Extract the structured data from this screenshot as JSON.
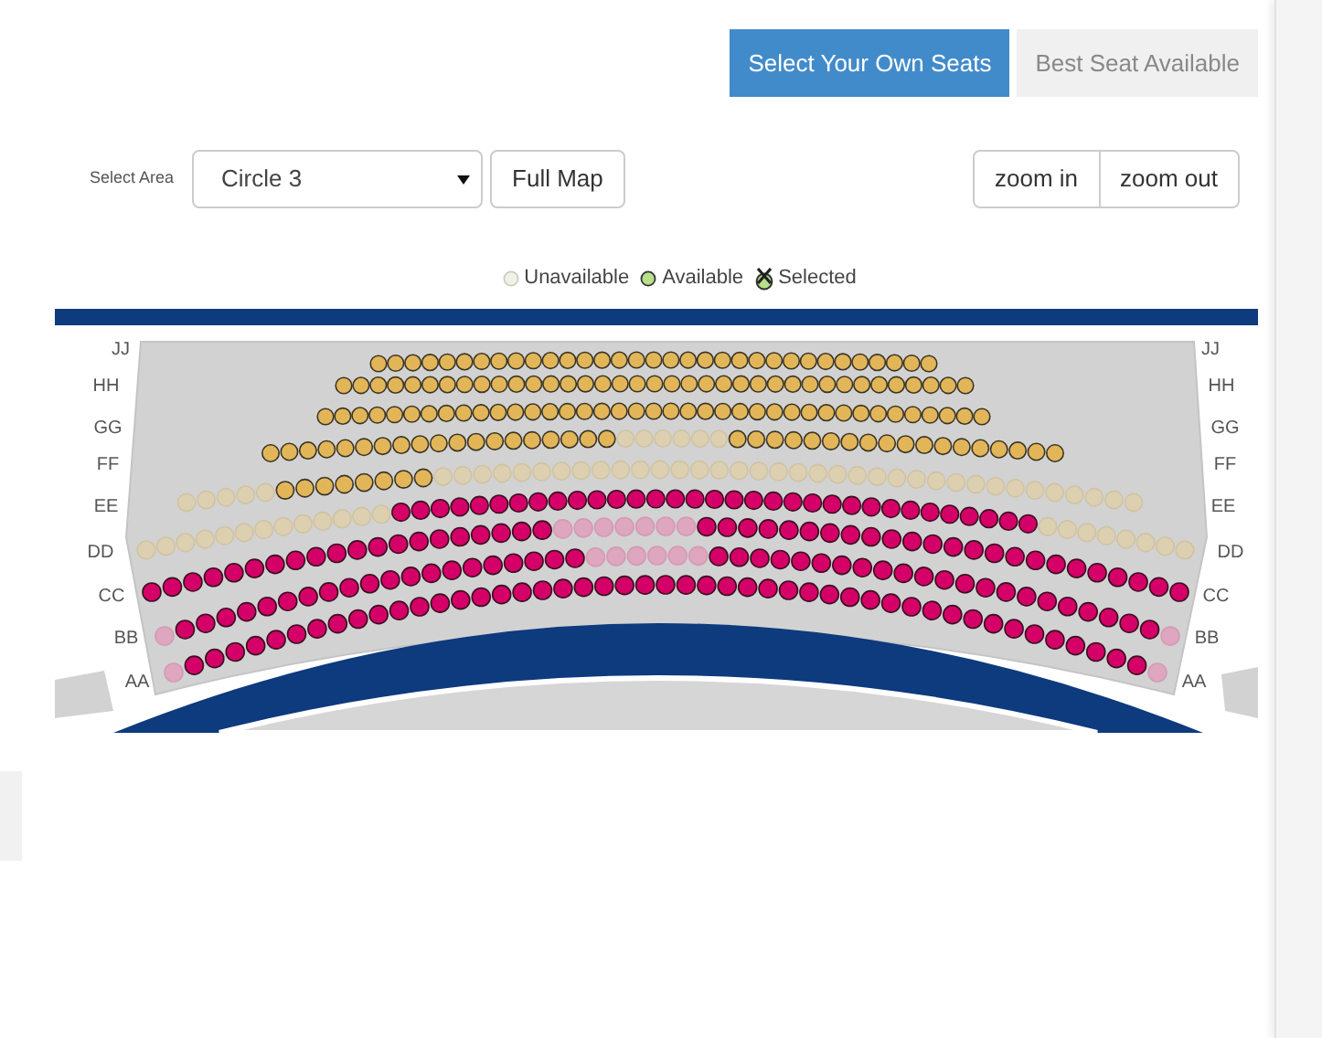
{
  "booking_modes": [
    {
      "label": "Select Your Own Seats",
      "selected": true
    },
    {
      "label": "Best Seat Available",
      "selected": false
    }
  ],
  "area": {
    "label": "Select Area",
    "value": "Circle 3",
    "full_map": "Full Map"
  },
  "zoom": {
    "zoom_in": "zoom in",
    "zoom_out": "zoom out"
  },
  "legend": [
    {
      "kind": "unavailable",
      "label": "Unavailable"
    },
    {
      "kind": "available",
      "label": "Available"
    },
    {
      "kind": "selected",
      "label": "Selected"
    }
  ],
  "seat_map": {
    "rows": [
      {
        "left_label": "JJ",
        "right_label": "JJ",
        "seats": [
          {
            "kind": "upper",
            "available": true
          },
          {
            "kind": "upper",
            "available": true
          },
          {
            "kind": "upper",
            "available": true
          },
          {
            "kind": "upper",
            "available": true
          },
          {
            "kind": "upper",
            "available": true
          },
          {
            "kind": "upper",
            "available": true
          },
          {
            "kind": "upper",
            "available": true
          },
          {
            "kind": "upper",
            "available": true
          },
          {
            "kind": "upper",
            "available": true
          },
          {
            "kind": "upper",
            "available": true
          },
          {
            "kind": "upper",
            "available": true
          },
          {
            "kind": "upper",
            "available": true
          },
          {
            "kind": "upper",
            "available": true
          },
          {
            "kind": "upper",
            "available": true
          },
          {
            "kind": "upper",
            "available": true
          },
          {
            "kind": "upper",
            "available": true
          },
          {
            "kind": "upper",
            "available": true
          },
          {
            "kind": "upper",
            "available": true
          },
          {
            "kind": "upper",
            "available": true
          },
          {
            "kind": "upper",
            "available": true
          },
          {
            "kind": "upper",
            "available": true
          },
          {
            "kind": "upper",
            "available": true
          },
          {
            "kind": "upper",
            "available": true
          },
          {
            "kind": "upper",
            "available": true
          },
          {
            "kind": "upper",
            "available": true
          },
          {
            "kind": "upper",
            "available": true
          },
          {
            "kind": "upper",
            "available": true
          },
          {
            "kind": "upper",
            "available": true
          },
          {
            "kind": "upper",
            "available": true
          },
          {
            "kind": "upper",
            "available": true
          },
          {
            "kind": "upper",
            "available": true
          },
          {
            "kind": "upper",
            "available": true
          },
          {
            "kind": "upper",
            "available": true
          }
        ]
      },
      {
        "left_label": "HH",
        "right_label": "HH",
        "seats": [
          {
            "kind": "upper",
            "available": true
          },
          {
            "kind": "upper",
            "available": true
          },
          {
            "kind": "upper",
            "available": true
          },
          {
            "kind": "upper",
            "available": true
          },
          {
            "kind": "upper",
            "available": true
          },
          {
            "kind": "upper",
            "available": true
          },
          {
            "kind": "upper",
            "available": true
          },
          {
            "kind": "upper",
            "available": true
          },
          {
            "kind": "upper",
            "available": true
          },
          {
            "kind": "upper",
            "available": true
          },
          {
            "kind": "upper",
            "available": true
          },
          {
            "kind": "upper",
            "available": true
          },
          {
            "kind": "upper",
            "available": true
          },
          {
            "kind": "upper",
            "available": true
          },
          {
            "kind": "upper",
            "available": true
          },
          {
            "kind": "upper",
            "available": true
          },
          {
            "kind": "upper",
            "available": true
          },
          {
            "kind": "upper",
            "available": true
          },
          {
            "kind": "upper",
            "available": true
          },
          {
            "kind": "upper",
            "available": true
          },
          {
            "kind": "upper",
            "available": true
          },
          {
            "kind": "upper",
            "available": true
          },
          {
            "kind": "upper",
            "available": true
          },
          {
            "kind": "upper",
            "available": true
          },
          {
            "kind": "upper",
            "available": true
          },
          {
            "kind": "upper",
            "available": true
          },
          {
            "kind": "upper",
            "available": true
          },
          {
            "kind": "upper",
            "available": true
          },
          {
            "kind": "upper",
            "available": true
          },
          {
            "kind": "upper",
            "available": true
          },
          {
            "kind": "upper",
            "available": true
          },
          {
            "kind": "upper",
            "available": true
          },
          {
            "kind": "upper",
            "available": true
          },
          {
            "kind": "upper",
            "available": true
          },
          {
            "kind": "upper",
            "available": true
          },
          {
            "kind": "upper",
            "available": true
          },
          {
            "kind": "upper",
            "available": true
          }
        ]
      },
      {
        "left_label": "GG",
        "right_label": "GG",
        "seats": [
          {
            "kind": "upper",
            "available": true
          },
          {
            "kind": "upper",
            "available": true
          },
          {
            "kind": "upper",
            "available": true
          },
          {
            "kind": "upper",
            "available": true
          },
          {
            "kind": "upper",
            "available": true
          },
          {
            "kind": "upper",
            "available": true
          },
          {
            "kind": "upper",
            "available": true
          },
          {
            "kind": "upper",
            "available": true
          },
          {
            "kind": "upper",
            "available": true
          },
          {
            "kind": "upper",
            "available": true
          },
          {
            "kind": "upper",
            "available": true
          },
          {
            "kind": "upper",
            "available": true
          },
          {
            "kind": "upper",
            "available": true
          },
          {
            "kind": "upper",
            "available": true
          },
          {
            "kind": "upper",
            "available": true
          },
          {
            "kind": "upper",
            "available": true
          },
          {
            "kind": "upper",
            "available": true
          },
          {
            "kind": "upper",
            "available": true
          },
          {
            "kind": "upper",
            "available": true
          },
          {
            "kind": "upper",
            "available": true
          },
          {
            "kind": "upper",
            "available": true
          },
          {
            "kind": "upper",
            "available": true
          },
          {
            "kind": "upper",
            "available": true
          },
          {
            "kind": "upper",
            "available": true
          },
          {
            "kind": "upper",
            "available": true
          },
          {
            "kind": "upper",
            "available": true
          },
          {
            "kind": "upper",
            "available": true
          },
          {
            "kind": "upper",
            "available": true
          },
          {
            "kind": "upper",
            "available": true
          },
          {
            "kind": "upper",
            "available": true
          },
          {
            "kind": "upper",
            "available": true
          },
          {
            "kind": "upper",
            "available": true
          },
          {
            "kind": "upper",
            "available": true
          },
          {
            "kind": "upper",
            "available": true
          },
          {
            "kind": "upper",
            "available": true
          },
          {
            "kind": "upper",
            "available": true
          },
          {
            "kind": "upper",
            "available": true
          },
          {
            "kind": "upper",
            "available": true
          },
          {
            "kind": "upper",
            "available": true
          }
        ]
      },
      {
        "left_label": "FF",
        "right_label": "FF",
        "seats": [
          {
            "kind": "upper",
            "available": true
          },
          {
            "kind": "upper",
            "available": true
          },
          {
            "kind": "upper",
            "available": true
          },
          {
            "kind": "upper",
            "available": true
          },
          {
            "kind": "upper",
            "available": true
          },
          {
            "kind": "upper",
            "available": true
          },
          {
            "kind": "upper",
            "available": true
          },
          {
            "kind": "upper",
            "available": true
          },
          {
            "kind": "upper",
            "available": true
          },
          {
            "kind": "upper",
            "available": true
          },
          {
            "kind": "upper",
            "available": true
          },
          {
            "kind": "upper",
            "available": true
          },
          {
            "kind": "upper",
            "available": true
          },
          {
            "kind": "upper",
            "available": true
          },
          {
            "kind": "upper",
            "available": true
          },
          {
            "kind": "upper",
            "available": true
          },
          {
            "kind": "upper",
            "available": true
          },
          {
            "kind": "upper",
            "available": true
          },
          {
            "kind": "upper",
            "available": true
          },
          {
            "kind": "upper",
            "available": false
          },
          {
            "kind": "upper",
            "available": false
          },
          {
            "kind": "upper",
            "available": false
          },
          {
            "kind": "upper",
            "available": false
          },
          {
            "kind": "upper",
            "available": false
          },
          {
            "kind": "upper",
            "available": false
          },
          {
            "kind": "upper",
            "available": true
          },
          {
            "kind": "upper",
            "available": true
          },
          {
            "kind": "upper",
            "available": true
          },
          {
            "kind": "upper",
            "available": true
          },
          {
            "kind": "upper",
            "available": true
          },
          {
            "kind": "upper",
            "available": true
          },
          {
            "kind": "upper",
            "available": true
          },
          {
            "kind": "upper",
            "available": true
          },
          {
            "kind": "upper",
            "available": true
          },
          {
            "kind": "upper",
            "available": true
          },
          {
            "kind": "upper",
            "available": true
          },
          {
            "kind": "upper",
            "available": true
          },
          {
            "kind": "upper",
            "available": true
          },
          {
            "kind": "upper",
            "available": true
          },
          {
            "kind": "upper",
            "available": true
          },
          {
            "kind": "upper",
            "available": true
          },
          {
            "kind": "upper",
            "available": true
          },
          {
            "kind": "upper",
            "available": true
          }
        ]
      },
      {
        "left_label": "EE",
        "right_label": "EE",
        "seats": [
          {
            "kind": "upper",
            "available": false
          },
          {
            "kind": "upper",
            "available": false
          },
          {
            "kind": "upper",
            "available": false
          },
          {
            "kind": "upper",
            "available": false
          },
          {
            "kind": "upper",
            "available": false
          },
          {
            "kind": "upper",
            "available": true
          },
          {
            "kind": "upper",
            "available": true
          },
          {
            "kind": "upper",
            "available": true
          },
          {
            "kind": "upper",
            "available": true
          },
          {
            "kind": "upper",
            "available": true
          },
          {
            "kind": "upper",
            "available": true
          },
          {
            "kind": "upper",
            "available": true
          },
          {
            "kind": "upper",
            "available": true
          },
          {
            "kind": "upper",
            "available": false
          },
          {
            "kind": "upper",
            "available": false
          },
          {
            "kind": "upper",
            "available": false
          },
          {
            "kind": "upper",
            "available": false
          },
          {
            "kind": "upper",
            "available": false
          },
          {
            "kind": "upper",
            "available": false
          },
          {
            "kind": "upper",
            "available": false
          },
          {
            "kind": "upper",
            "available": false
          },
          {
            "kind": "upper",
            "available": false
          },
          {
            "kind": "upper",
            "available": false
          },
          {
            "kind": "upper",
            "available": false
          },
          {
            "kind": "upper",
            "available": false
          },
          {
            "kind": "upper",
            "available": false
          },
          {
            "kind": "upper",
            "available": false
          },
          {
            "kind": "upper",
            "available": false
          },
          {
            "kind": "upper",
            "available": false
          },
          {
            "kind": "upper",
            "available": false
          },
          {
            "kind": "upper",
            "available": false
          },
          {
            "kind": "upper",
            "available": false
          },
          {
            "kind": "upper",
            "available": false
          },
          {
            "kind": "upper",
            "available": false
          },
          {
            "kind": "upper",
            "available": false
          },
          {
            "kind": "upper",
            "available": false
          },
          {
            "kind": "upper",
            "available": false
          },
          {
            "kind": "upper",
            "available": false
          },
          {
            "kind": "upper",
            "available": false
          },
          {
            "kind": "upper",
            "available": false
          },
          {
            "kind": "upper",
            "available": false
          },
          {
            "kind": "upper",
            "available": false
          },
          {
            "kind": "upper",
            "available": false
          },
          {
            "kind": "upper",
            "available": false
          },
          {
            "kind": "upper",
            "available": false
          },
          {
            "kind": "upper",
            "available": false
          },
          {
            "kind": "upper",
            "available": false
          },
          {
            "kind": "upper",
            "available": false
          },
          {
            "kind": "upper",
            "available": false
          }
        ]
      },
      {
        "left_label": "DD",
        "right_label": "DD",
        "seats": [
          {
            "kind": "upper",
            "available": false
          },
          {
            "kind": "upper",
            "available": false
          },
          {
            "kind": "upper",
            "available": false
          },
          {
            "kind": "upper",
            "available": false
          },
          {
            "kind": "upper",
            "available": false
          },
          {
            "kind": "upper",
            "available": false
          },
          {
            "kind": "upper",
            "available": false
          },
          {
            "kind": "upper",
            "available": false
          },
          {
            "kind": "upper",
            "available": false
          },
          {
            "kind": "upper",
            "available": false
          },
          {
            "kind": "upper",
            "available": false
          },
          {
            "kind": "upper",
            "available": false
          },
          {
            "kind": "upper",
            "available": false
          },
          {
            "kind": "lower",
            "available": true
          },
          {
            "kind": "lower",
            "available": true
          },
          {
            "kind": "lower",
            "available": true
          },
          {
            "kind": "lower",
            "available": true
          },
          {
            "kind": "lower",
            "available": true
          },
          {
            "kind": "lower",
            "available": true
          },
          {
            "kind": "lower",
            "available": true
          },
          {
            "kind": "lower",
            "available": true
          },
          {
            "kind": "lower",
            "available": true
          },
          {
            "kind": "lower",
            "available": true
          },
          {
            "kind": "lower",
            "available": true
          },
          {
            "kind": "lower",
            "available": true
          },
          {
            "kind": "lower",
            "available": true
          },
          {
            "kind": "lower",
            "available": true
          },
          {
            "kind": "lower",
            "available": true
          },
          {
            "kind": "lower",
            "available": true
          },
          {
            "kind": "lower",
            "available": true
          },
          {
            "kind": "lower",
            "available": true
          },
          {
            "kind": "lower",
            "available": true
          },
          {
            "kind": "lower",
            "available": true
          },
          {
            "kind": "lower",
            "available": true
          },
          {
            "kind": "lower",
            "available": true
          },
          {
            "kind": "lower",
            "available": true
          },
          {
            "kind": "lower",
            "available": true
          },
          {
            "kind": "lower",
            "available": true
          },
          {
            "kind": "lower",
            "available": true
          },
          {
            "kind": "lower",
            "available": true
          },
          {
            "kind": "lower",
            "available": true
          },
          {
            "kind": "lower",
            "available": true
          },
          {
            "kind": "lower",
            "available": true
          },
          {
            "kind": "lower",
            "available": true
          },
          {
            "kind": "lower",
            "available": true
          },
          {
            "kind": "lower",
            "available": true
          },
          {
            "kind": "upper",
            "available": false
          },
          {
            "kind": "upper",
            "available": false
          },
          {
            "kind": "upper",
            "available": false
          },
          {
            "kind": "upper",
            "available": false
          },
          {
            "kind": "upper",
            "available": false
          },
          {
            "kind": "upper",
            "available": false
          },
          {
            "kind": "upper",
            "available": false
          },
          {
            "kind": "upper",
            "available": false
          }
        ]
      },
      {
        "left_label": "CC",
        "right_label": "CC",
        "seats": [
          {
            "kind": "lower",
            "available": true
          },
          {
            "kind": "lower",
            "available": true
          },
          {
            "kind": "lower",
            "available": true
          },
          {
            "kind": "lower",
            "available": true
          },
          {
            "kind": "lower",
            "available": true
          },
          {
            "kind": "lower",
            "available": true
          },
          {
            "kind": "lower",
            "available": true
          },
          {
            "kind": "lower",
            "available": true
          },
          {
            "kind": "lower",
            "available": true
          },
          {
            "kind": "lower",
            "available": true
          },
          {
            "kind": "lower",
            "available": true
          },
          {
            "kind": "lower",
            "available": true
          },
          {
            "kind": "lower",
            "available": true
          },
          {
            "kind": "lower",
            "available": true
          },
          {
            "kind": "lower",
            "available": true
          },
          {
            "kind": "lower",
            "available": true
          },
          {
            "kind": "lower",
            "available": true
          },
          {
            "kind": "lower",
            "available": true
          },
          {
            "kind": "lower",
            "available": true
          },
          {
            "kind": "lower",
            "available": true
          },
          {
            "kind": "lower",
            "available": false
          },
          {
            "kind": "lower",
            "available": false
          },
          {
            "kind": "lower",
            "available": false
          },
          {
            "kind": "lower",
            "available": false
          },
          {
            "kind": "lower",
            "available": false
          },
          {
            "kind": "lower",
            "available": false
          },
          {
            "kind": "lower",
            "available": false
          },
          {
            "kind": "lower",
            "available": true
          },
          {
            "kind": "lower",
            "available": true
          },
          {
            "kind": "lower",
            "available": true
          },
          {
            "kind": "lower",
            "available": true
          },
          {
            "kind": "lower",
            "available": true
          },
          {
            "kind": "lower",
            "available": true
          },
          {
            "kind": "lower",
            "available": true
          },
          {
            "kind": "lower",
            "available": true
          },
          {
            "kind": "lower",
            "available": true
          },
          {
            "kind": "lower",
            "available": true
          },
          {
            "kind": "lower",
            "available": true
          },
          {
            "kind": "lower",
            "available": true
          },
          {
            "kind": "lower",
            "available": true
          },
          {
            "kind": "lower",
            "available": true
          },
          {
            "kind": "lower",
            "available": true
          },
          {
            "kind": "lower",
            "available": true
          },
          {
            "kind": "lower",
            "available": true
          },
          {
            "kind": "lower",
            "available": true
          },
          {
            "kind": "lower",
            "available": true
          },
          {
            "kind": "lower",
            "available": true
          },
          {
            "kind": "lower",
            "available": true
          },
          {
            "kind": "lower",
            "available": true
          },
          {
            "kind": "lower",
            "available": true
          },
          {
            "kind": "lower",
            "available": true
          }
        ]
      },
      {
        "left_label": "BB",
        "right_label": "BB",
        "seats": [
          {
            "kind": "lower",
            "available": false
          },
          {
            "kind": "lower",
            "available": true
          },
          {
            "kind": "lower",
            "available": true
          },
          {
            "kind": "lower",
            "available": true
          },
          {
            "kind": "lower",
            "available": true
          },
          {
            "kind": "lower",
            "available": true
          },
          {
            "kind": "lower",
            "available": true
          },
          {
            "kind": "lower",
            "available": true
          },
          {
            "kind": "lower",
            "available": true
          },
          {
            "kind": "lower",
            "available": true
          },
          {
            "kind": "lower",
            "available": true
          },
          {
            "kind": "lower",
            "available": true
          },
          {
            "kind": "lower",
            "available": true
          },
          {
            "kind": "lower",
            "available": true
          },
          {
            "kind": "lower",
            "available": true
          },
          {
            "kind": "lower",
            "available": true
          },
          {
            "kind": "lower",
            "available": true
          },
          {
            "kind": "lower",
            "available": true
          },
          {
            "kind": "lower",
            "available": true
          },
          {
            "kind": "lower",
            "available": true
          },
          {
            "kind": "lower",
            "available": true
          },
          {
            "kind": "lower",
            "available": false
          },
          {
            "kind": "lower",
            "available": false
          },
          {
            "kind": "lower",
            "available": false
          },
          {
            "kind": "lower",
            "available": false
          },
          {
            "kind": "lower",
            "available": false
          },
          {
            "kind": "lower",
            "available": false
          },
          {
            "kind": "lower",
            "available": true
          },
          {
            "kind": "lower",
            "available": true
          },
          {
            "kind": "lower",
            "available": true
          },
          {
            "kind": "lower",
            "available": true
          },
          {
            "kind": "lower",
            "available": true
          },
          {
            "kind": "lower",
            "available": true
          },
          {
            "kind": "lower",
            "available": true
          },
          {
            "kind": "lower",
            "available": true
          },
          {
            "kind": "lower",
            "available": true
          },
          {
            "kind": "lower",
            "available": true
          },
          {
            "kind": "lower",
            "available": true
          },
          {
            "kind": "lower",
            "available": true
          },
          {
            "kind": "lower",
            "available": true
          },
          {
            "kind": "lower",
            "available": true
          },
          {
            "kind": "lower",
            "available": true
          },
          {
            "kind": "lower",
            "available": true
          },
          {
            "kind": "lower",
            "available": true
          },
          {
            "kind": "lower",
            "available": true
          },
          {
            "kind": "lower",
            "available": true
          },
          {
            "kind": "lower",
            "available": true
          },
          {
            "kind": "lower",
            "available": true
          },
          {
            "kind": "lower",
            "available": true
          },
          {
            "kind": "lower",
            "available": false
          }
        ]
      },
      {
        "left_label": "AA",
        "right_label": "AA",
        "seats": [
          {
            "kind": "lower",
            "available": false
          },
          {
            "kind": "lower",
            "available": true
          },
          {
            "kind": "lower",
            "available": true
          },
          {
            "kind": "lower",
            "available": true
          },
          {
            "kind": "lower",
            "available": true
          },
          {
            "kind": "lower",
            "available": true
          },
          {
            "kind": "lower",
            "available": true
          },
          {
            "kind": "lower",
            "available": true
          },
          {
            "kind": "lower",
            "available": true
          },
          {
            "kind": "lower",
            "available": true
          },
          {
            "kind": "lower",
            "available": true
          },
          {
            "kind": "lower",
            "available": true
          },
          {
            "kind": "lower",
            "available": true
          },
          {
            "kind": "lower",
            "available": true
          },
          {
            "kind": "lower",
            "available": true
          },
          {
            "kind": "lower",
            "available": true
          },
          {
            "kind": "lower",
            "available": true
          },
          {
            "kind": "lower",
            "available": true
          },
          {
            "kind": "lower",
            "available": true
          },
          {
            "kind": "lower",
            "available": true
          },
          {
            "kind": "lower",
            "available": true
          },
          {
            "kind": "lower",
            "available": true
          },
          {
            "kind": "lower",
            "available": true
          },
          {
            "kind": "lower",
            "available": true
          },
          {
            "kind": "lower",
            "available": true
          },
          {
            "kind": "lower",
            "available": true
          },
          {
            "kind": "lower",
            "available": true
          },
          {
            "kind": "lower",
            "available": true
          },
          {
            "kind": "lower",
            "available": true
          },
          {
            "kind": "lower",
            "available": true
          },
          {
            "kind": "lower",
            "available": true
          },
          {
            "kind": "lower",
            "available": true
          },
          {
            "kind": "lower",
            "available": true
          },
          {
            "kind": "lower",
            "available": true
          },
          {
            "kind": "lower",
            "available": true
          },
          {
            "kind": "lower",
            "available": true
          },
          {
            "kind": "lower",
            "available": true
          },
          {
            "kind": "lower",
            "available": true
          },
          {
            "kind": "lower",
            "available": true
          },
          {
            "kind": "lower",
            "available": true
          },
          {
            "kind": "lower",
            "available": true
          },
          {
            "kind": "lower",
            "available": true
          },
          {
            "kind": "lower",
            "available": true
          },
          {
            "kind": "lower",
            "available": true
          },
          {
            "kind": "lower",
            "available": true
          },
          {
            "kind": "lower",
            "available": true
          },
          {
            "kind": "lower",
            "available": true
          },
          {
            "kind": "lower",
            "available": true
          },
          {
            "kind": "lower",
            "available": false
          }
        ]
      }
    ]
  }
}
